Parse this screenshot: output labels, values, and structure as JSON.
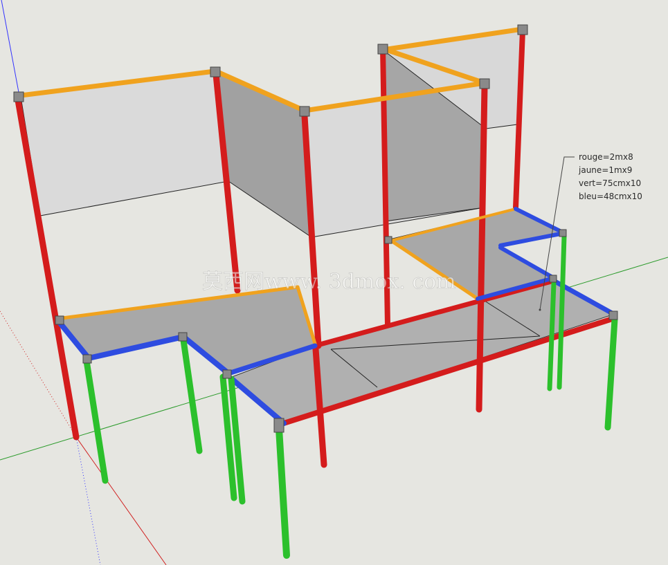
{
  "legend": {
    "lines": [
      "rouge=2mx8",
      "jaune=1mx9",
      "vert=75cmx10",
      "bleu=48cmx10"
    ]
  },
  "watermark": {
    "text": "莫西网www. 3dmox. com"
  },
  "colors": {
    "background": "#e6e6e1",
    "rouge": "#d41c1c",
    "jaune": "#f0a21e",
    "vert": "#2cc02c",
    "bleu": "#2e4ce0",
    "panel": "#d9d9d9",
    "panel_shadow": "#9e9e9e",
    "desk_top": "#a9a9a9",
    "joint": "#8a8a8a",
    "axis_blue": "#3030ff",
    "axis_green": "#2a9a2a",
    "axis_red": "#d02020"
  }
}
